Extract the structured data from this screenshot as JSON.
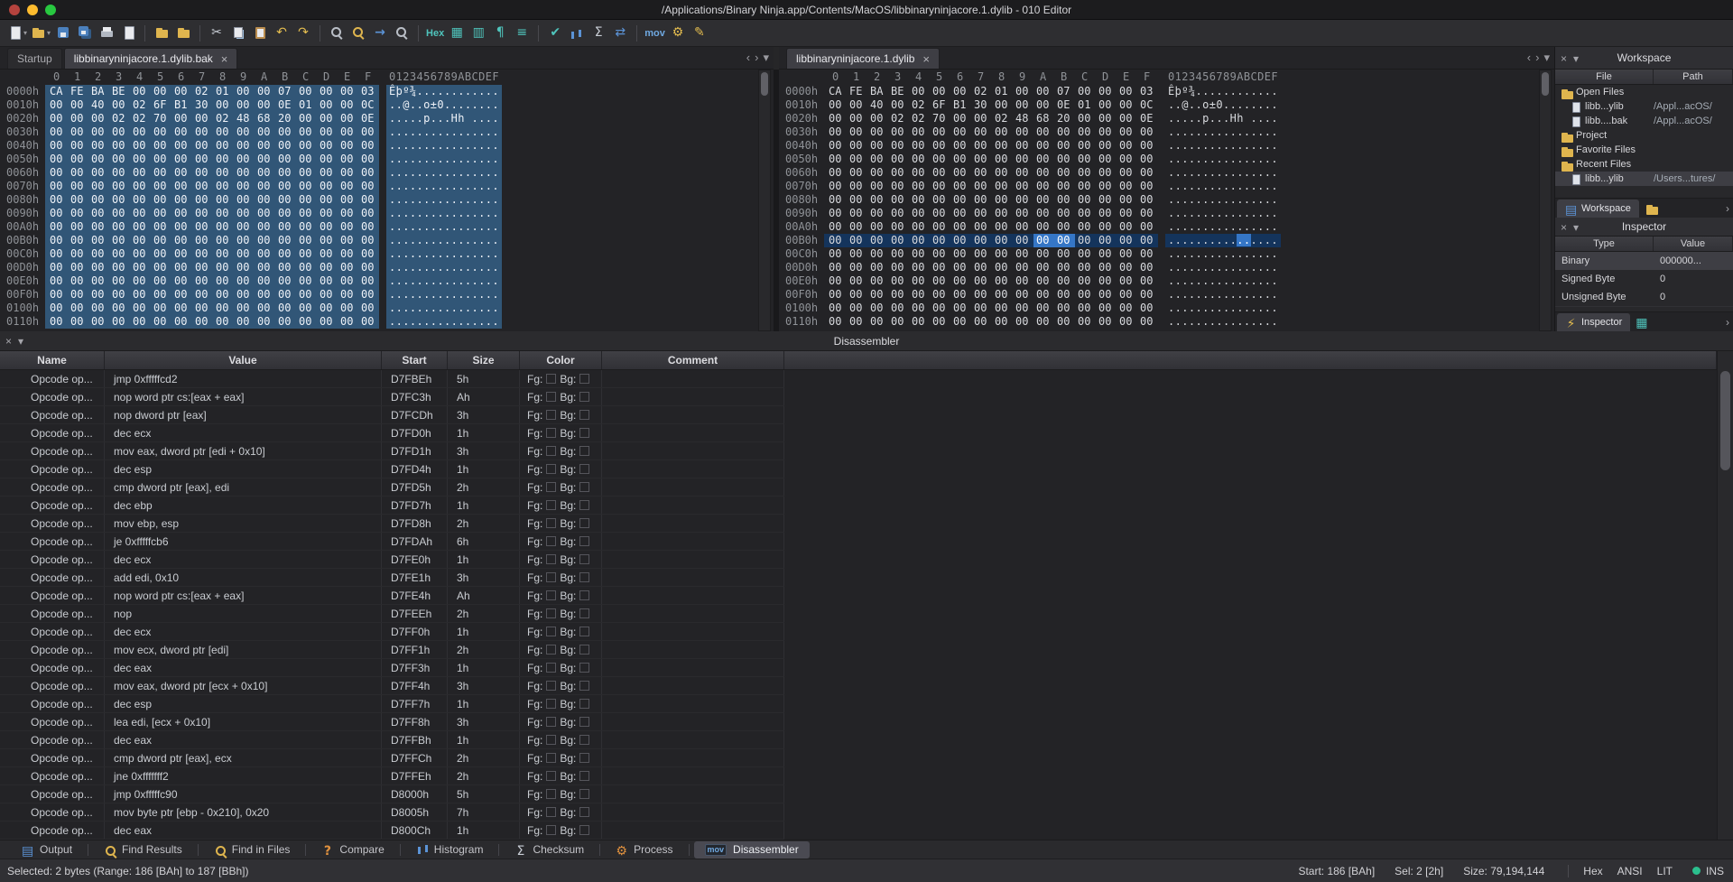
{
  "window": {
    "title": "/Applications/Binary Ninja.app/Contents/MacOS/libbinaryninjacore.1.dylib - 010 Editor"
  },
  "toolbar": {
    "buttons": [
      {
        "name": "new-file",
        "icon": "page",
        "caret": true
      },
      {
        "name": "open-file",
        "icon": "folder",
        "caret": true
      },
      {
        "name": "save",
        "icon": "disk"
      },
      {
        "name": "save-all",
        "icon": "disk-multi"
      },
      {
        "name": "print",
        "icon": "printer"
      },
      {
        "name": "print-preview",
        "icon": "page"
      },
      {
        "sep": true
      },
      {
        "name": "open-folder",
        "icon": "folder"
      },
      {
        "name": "favorite-files",
        "icon": "folder"
      },
      {
        "sep": true
      },
      {
        "name": "cut",
        "icon": "cut",
        "glyph": true
      },
      {
        "name": "copy",
        "icon": "copy"
      },
      {
        "name": "paste",
        "icon": "paste"
      },
      {
        "name": "undo",
        "icon": "undo",
        "glyph": true
      },
      {
        "name": "redo",
        "icon": "redo",
        "glyph": true
      },
      {
        "sep": true
      },
      {
        "name": "find",
        "icon": "magnifier"
      },
      {
        "name": "replace",
        "icon": "magnifier-y"
      },
      {
        "name": "goto",
        "icon": "goto",
        "glyph": true
      },
      {
        "name": "find-in-files",
        "icon": "magnifier"
      },
      {
        "sep": true
      },
      {
        "name": "hex-view",
        "text": "Hex",
        "color": "#4fc4bc"
      },
      {
        "name": "split-view",
        "icon": "grid",
        "glyph": true
      },
      {
        "name": "linked-view",
        "icon": "grid2",
        "glyph": true
      },
      {
        "name": "show-whitespace",
        "icon": "para",
        "glyph": true
      },
      {
        "name": "ruler",
        "icon": "ruler",
        "glyph": true
      },
      {
        "sep": true
      },
      {
        "name": "validate",
        "icon": "check",
        "glyph": true
      },
      {
        "name": "histogram",
        "icon": "bars"
      },
      {
        "name": "checksum",
        "icon": "sigma",
        "glyph": true
      },
      {
        "name": "compare",
        "icon": "compare",
        "glyph": true
      },
      {
        "sep": true
      },
      {
        "name": "disassemble",
        "text": "mov",
        "color": "#6fa8e0"
      },
      {
        "name": "run-template",
        "icon": "gear",
        "glyph": true
      },
      {
        "name": "edit-script",
        "icon": "pencil",
        "glyph": true
      }
    ]
  },
  "tabs": {
    "left": [
      {
        "label": "Startup",
        "active": false,
        "closable": false
      },
      {
        "label": "libbinaryninjacore.1.dylib.bak",
        "active": true,
        "closable": true
      }
    ],
    "right": [
      {
        "label": "libbinaryninjacore.1.dylib",
        "active": true,
        "closable": true
      }
    ]
  },
  "hex": {
    "byte_headers": [
      "0",
      "1",
      "2",
      "3",
      "4",
      "5",
      "6",
      "7",
      "8",
      "9",
      "A",
      "B",
      "C",
      "D",
      "E",
      "F"
    ],
    "ascii_header": "0123456789ABCDEF",
    "selection": {
      "row_addr": "00B0h",
      "cols": [
        10,
        11
      ]
    },
    "rows": [
      {
        "addr": "0000h",
        "bytes": "CA FE BA BE 00 00 00 02 01 00 00 07 00 00 00 03",
        "ascii": "Êþº¾............"
      },
      {
        "addr": "0010h",
        "bytes": "00 00 40 00 02 6F B1 30 00 00 00 0E 01 00 00 0C",
        "ascii": "..@..o±0........"
      },
      {
        "addr": "0020h",
        "bytes": "00 00 00 02 02 70 00 00 02 48 68 20 00 00 00 0E",
        "ascii": ".....p...Hh ...."
      },
      {
        "addr": "0030h",
        "bytes": "00 00 00 00 00 00 00 00 00 00 00 00 00 00 00 00",
        "ascii": "................"
      },
      {
        "addr": "0040h",
        "bytes": "00 00 00 00 00 00 00 00 00 00 00 00 00 00 00 00",
        "ascii": "................"
      },
      {
        "addr": "0050h",
        "bytes": "00 00 00 00 00 00 00 00 00 00 00 00 00 00 00 00",
        "ascii": "................"
      },
      {
        "addr": "0060h",
        "bytes": "00 00 00 00 00 00 00 00 00 00 00 00 00 00 00 00",
        "ascii": "................"
      },
      {
        "addr": "0070h",
        "bytes": "00 00 00 00 00 00 00 00 00 00 00 00 00 00 00 00",
        "ascii": "................"
      },
      {
        "addr": "0080h",
        "bytes": "00 00 00 00 00 00 00 00 00 00 00 00 00 00 00 00",
        "ascii": "................"
      },
      {
        "addr": "0090h",
        "bytes": "00 00 00 00 00 00 00 00 00 00 00 00 00 00 00 00",
        "ascii": "................"
      },
      {
        "addr": "00A0h",
        "bytes": "00 00 00 00 00 00 00 00 00 00 00 00 00 00 00 00",
        "ascii": "................"
      },
      {
        "addr": "00B0h",
        "bytes": "00 00 00 00 00 00 00 00 00 00 00 00 00 00 00 00",
        "ascii": "................"
      },
      {
        "addr": "00C0h",
        "bytes": "00 00 00 00 00 00 00 00 00 00 00 00 00 00 00 00",
        "ascii": "................"
      },
      {
        "addr": "00D0h",
        "bytes": "00 00 00 00 00 00 00 00 00 00 00 00 00 00 00 00",
        "ascii": "................"
      },
      {
        "addr": "00E0h",
        "bytes": "00 00 00 00 00 00 00 00 00 00 00 00 00 00 00 00",
        "ascii": "................"
      },
      {
        "addr": "00F0h",
        "bytes": "00 00 00 00 00 00 00 00 00 00 00 00 00 00 00 00",
        "ascii": "................"
      },
      {
        "addr": "0100h",
        "bytes": "00 00 00 00 00 00 00 00 00 00 00 00 00 00 00 00",
        "ascii": "................"
      },
      {
        "addr": "0110h",
        "bytes": "00 00 00 00 00 00 00 00 00 00 00 00 00 00 00 00",
        "ascii": "................"
      }
    ]
  },
  "workspace": {
    "title": "Workspace",
    "columns": [
      "File",
      "Path"
    ],
    "rows": [
      {
        "type": "folder",
        "label": "Open Files"
      },
      {
        "type": "file",
        "file": "libb...ylib",
        "path": "/Appl...acOS/"
      },
      {
        "type": "file",
        "file": "libb....bak",
        "path": "/Appl...acOS/"
      },
      {
        "type": "folder",
        "label": "Project"
      },
      {
        "type": "folder",
        "label": "Favorite Files"
      },
      {
        "type": "folder",
        "label": "Recent Files"
      },
      {
        "type": "file",
        "file": "libb...ylib",
        "path": "/Users...tures/",
        "selected": true
      }
    ],
    "tab_label": "Workspace"
  },
  "inspector": {
    "title": "Inspector",
    "columns": [
      "Type",
      "Value"
    ],
    "rows": [
      {
        "type": "Binary",
        "value": "000000...",
        "selected": true
      },
      {
        "type": "Signed Byte",
        "value": "0"
      },
      {
        "type": "Unsigned Byte",
        "value": "0"
      }
    ],
    "tab_label": "Inspector"
  },
  "disassembler": {
    "title": "Disassembler",
    "columns": [
      "Name",
      "Value",
      "Start",
      "Size",
      "Color",
      "Comment"
    ],
    "fg_label": "Fg:",
    "bg_label": "Bg:",
    "rows": [
      [
        "Opcode op...",
        "jmp 0xfffffcd2",
        "D7FBEh",
        "5h"
      ],
      [
        "Opcode op...",
        "nop word ptr cs:[eax + eax]",
        "D7FC3h",
        "Ah"
      ],
      [
        "Opcode op...",
        "nop dword ptr [eax]",
        "D7FCDh",
        "3h"
      ],
      [
        "Opcode op...",
        "dec ecx",
        "D7FD0h",
        "1h"
      ],
      [
        "Opcode op...",
        "mov eax, dword ptr [edi + 0x10]",
        "D7FD1h",
        "3h"
      ],
      [
        "Opcode op...",
        "dec esp",
        "D7FD4h",
        "1h"
      ],
      [
        "Opcode op...",
        "cmp dword ptr [eax], edi",
        "D7FD5h",
        "2h"
      ],
      [
        "Opcode op...",
        "dec ebp",
        "D7FD7h",
        "1h"
      ],
      [
        "Opcode op...",
        "mov ebp, esp",
        "D7FD8h",
        "2h"
      ],
      [
        "Opcode op...",
        "je 0xfffffcb6",
        "D7FDAh",
        "6h"
      ],
      [
        "Opcode op...",
        "dec ecx",
        "D7FE0h",
        "1h"
      ],
      [
        "Opcode op...",
        "add edi, 0x10",
        "D7FE1h",
        "3h"
      ],
      [
        "Opcode op...",
        "nop word ptr cs:[eax + eax]",
        "D7FE4h",
        "Ah"
      ],
      [
        "Opcode op...",
        "nop",
        "D7FEEh",
        "2h"
      ],
      [
        "Opcode op...",
        "dec ecx",
        "D7FF0h",
        "1h"
      ],
      [
        "Opcode op...",
        "mov ecx, dword ptr [edi]",
        "D7FF1h",
        "2h"
      ],
      [
        "Opcode op...",
        "dec eax",
        "D7FF3h",
        "1h"
      ],
      [
        "Opcode op...",
        "mov eax, dword ptr [ecx + 0x10]",
        "D7FF4h",
        "3h"
      ],
      [
        "Opcode op...",
        "dec esp",
        "D7FF7h",
        "1h"
      ],
      [
        "Opcode op...",
        "lea edi, [ecx + 0x10]",
        "D7FF8h",
        "3h"
      ],
      [
        "Opcode op...",
        "dec eax",
        "D7FFBh",
        "1h"
      ],
      [
        "Opcode op...",
        "cmp dword ptr [eax], ecx",
        "D7FFCh",
        "2h"
      ],
      [
        "Opcode op...",
        "jne 0xfffffff2",
        "D7FFEh",
        "2h"
      ],
      [
        "Opcode op...",
        "jmp 0xfffffc90",
        "D8000h",
        "5h"
      ],
      [
        "Opcode op...",
        "mov byte ptr [ebp - 0x210], 0x20",
        "D8005h",
        "7h"
      ],
      [
        "Opcode op...",
        "dec eax",
        "D800Ch",
        "1h"
      ]
    ]
  },
  "panel_tabs": [
    {
      "label": "Output",
      "icon": "grid3",
      "active": false
    },
    {
      "label": "Find Results",
      "icon": "magnifier-y",
      "active": false
    },
    {
      "label": "Find in Files",
      "icon": "magnifier-y",
      "active": false
    },
    {
      "label": "Compare",
      "icon": "question",
      "active": false
    },
    {
      "label": "Histogram",
      "icon": "bars",
      "active": false
    },
    {
      "label": "Checksum",
      "icon": "sigma",
      "active": false
    },
    {
      "label": "Process",
      "icon": "gear-o",
      "active": false
    },
    {
      "label": "Disassembler",
      "icon": "mov",
      "active": true
    }
  ],
  "statusbar": {
    "left": "Selected: 2 bytes (Range: 186 [BAh] to 187 [BBh])",
    "start": "Start: 186 [BAh]",
    "sel": "Sel: 2 [2h]",
    "size": "Size: 79,194,144",
    "mode": "Hex",
    "charset": "ANSI",
    "endian": "LIT",
    "insert": "INS"
  }
}
